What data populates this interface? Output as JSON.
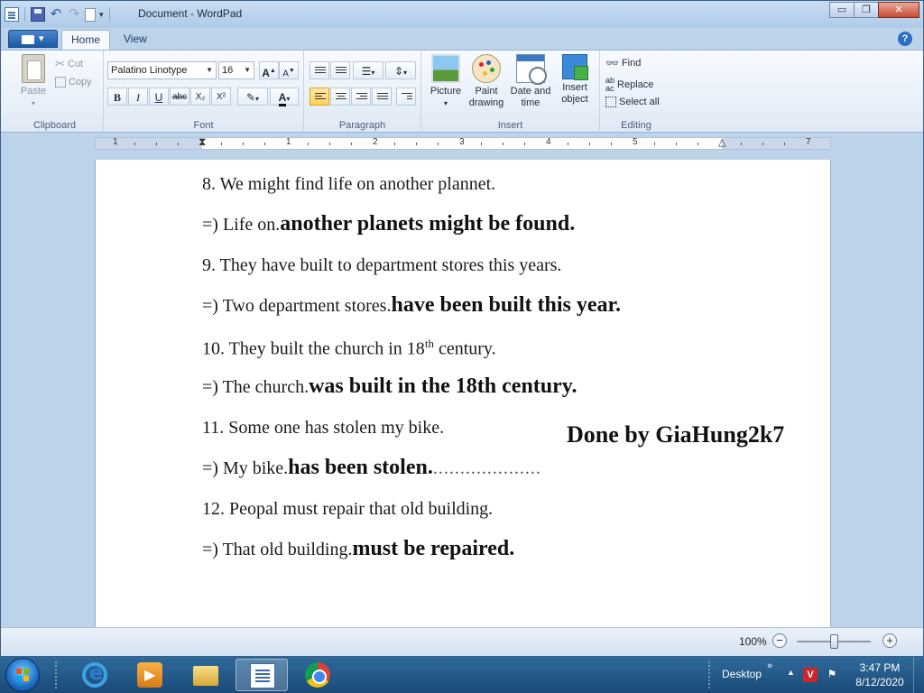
{
  "window": {
    "title": "Document - WordPad",
    "controls": {
      "minimize": "▭",
      "maximize": "❐",
      "close": "✕"
    }
  },
  "ribbon": {
    "tabs": [
      {
        "label": "Home",
        "active": true
      },
      {
        "label": "View",
        "active": false
      }
    ],
    "clipboard": {
      "paste": "Paste",
      "cut": "Cut",
      "copy": "Copy",
      "label": "Clipboard"
    },
    "font": {
      "family": "Palatino Linotype",
      "size": "16",
      "bold": "B",
      "italic": "I",
      "underline": "U",
      "strike": "abc",
      "subscript": "X₂",
      "superscript": "X²",
      "grow": "A",
      "shrink": "A",
      "label": "Font"
    },
    "paragraph": {
      "label": "Paragraph"
    },
    "insert": {
      "picture": "Picture",
      "paint": "Paint drawing",
      "datetime": "Date and time",
      "object": "Insert object",
      "label": "Insert"
    },
    "editing": {
      "find": "Find",
      "replace": "Replace",
      "select_all": "Select all",
      "label": "Editing"
    }
  },
  "ruler": {
    "numbers": [
      "1",
      "1",
      "1",
      "2",
      "3",
      "4",
      "5",
      "6",
      "7"
    ]
  },
  "document": {
    "lines": [
      {
        "text": "8. We might find life on another plannet."
      },
      {
        "prefix": "=) Life on.",
        "answer": "another planets might be found.",
        "trail": ""
      },
      {
        "text": "9. They have built to department stores this years."
      },
      {
        "prefix": "=) Two department stores.",
        "answer": "have been built this year.",
        "trail": ""
      },
      {
        "text_before": "10. They built the church in 18",
        "sup": "th",
        "text_after": " century."
      },
      {
        "prefix": "=) The church.",
        "answer": "was built in the 18th century.",
        "trail": ""
      },
      {
        "text": "11. Some one has stolen my bike."
      },
      {
        "prefix": "=) My bike.",
        "answer": "has been stolen.",
        "trail": "...................."
      },
      {
        "text": "12. Peopal must repair that old building."
      },
      {
        "prefix": "=) That old building.",
        "answer": "must be repaired.",
        "trail": ""
      }
    ],
    "watermark": "Done by GiaHung2k7"
  },
  "status": {
    "zoom": "100%",
    "zoom_level": 0.5
  },
  "taskbar": {
    "desktop": "Desktop",
    "clock_time": "3:47 PM",
    "clock_date": "8/12/2020"
  }
}
